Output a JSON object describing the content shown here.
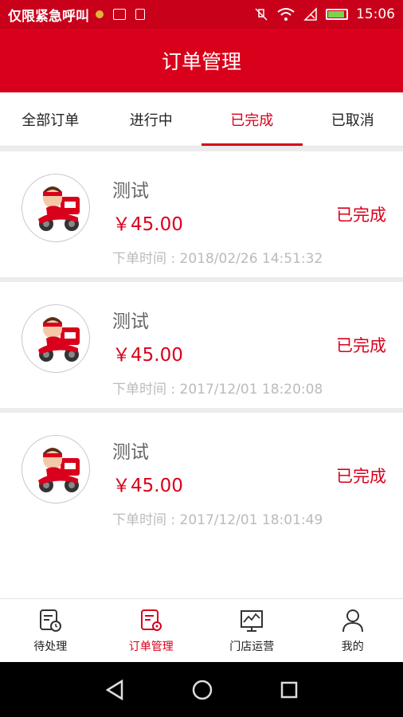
{
  "status_bar": {
    "left_text": "仅限紧急呼叫",
    "time": "15:06"
  },
  "header": {
    "title": "订单管理"
  },
  "tabs": [
    {
      "label": "全部订单",
      "active": false
    },
    {
      "label": "进行中",
      "active": false
    },
    {
      "label": "已完成",
      "active": true
    },
    {
      "label": "已取消",
      "active": false
    }
  ],
  "orders": [
    {
      "title": "测试",
      "price": "￥45.00",
      "status": "已完成",
      "time": "下单时间 : 2018/02/26 14:51:32"
    },
    {
      "title": "测试",
      "price": "￥45.00",
      "status": "已完成",
      "time": "下单时间 : 2017/12/01 18:20:08"
    },
    {
      "title": "测试",
      "price": "￥45.00",
      "status": "已完成",
      "time": "下单时间 : 2017/12/01 18:01:49"
    }
  ],
  "bottom_nav": [
    {
      "label": "待处理",
      "icon": "pending-clock-icon",
      "active": false
    },
    {
      "label": "订单管理",
      "icon": "order-settings-icon",
      "active": true
    },
    {
      "label": "门店运营",
      "icon": "store-monitor-icon",
      "active": false
    },
    {
      "label": "我的",
      "icon": "profile-icon",
      "active": false
    }
  ],
  "colors": {
    "primary": "#d9001b",
    "status_bar": "#c8001a",
    "muted_text": "#bbbbbb"
  }
}
